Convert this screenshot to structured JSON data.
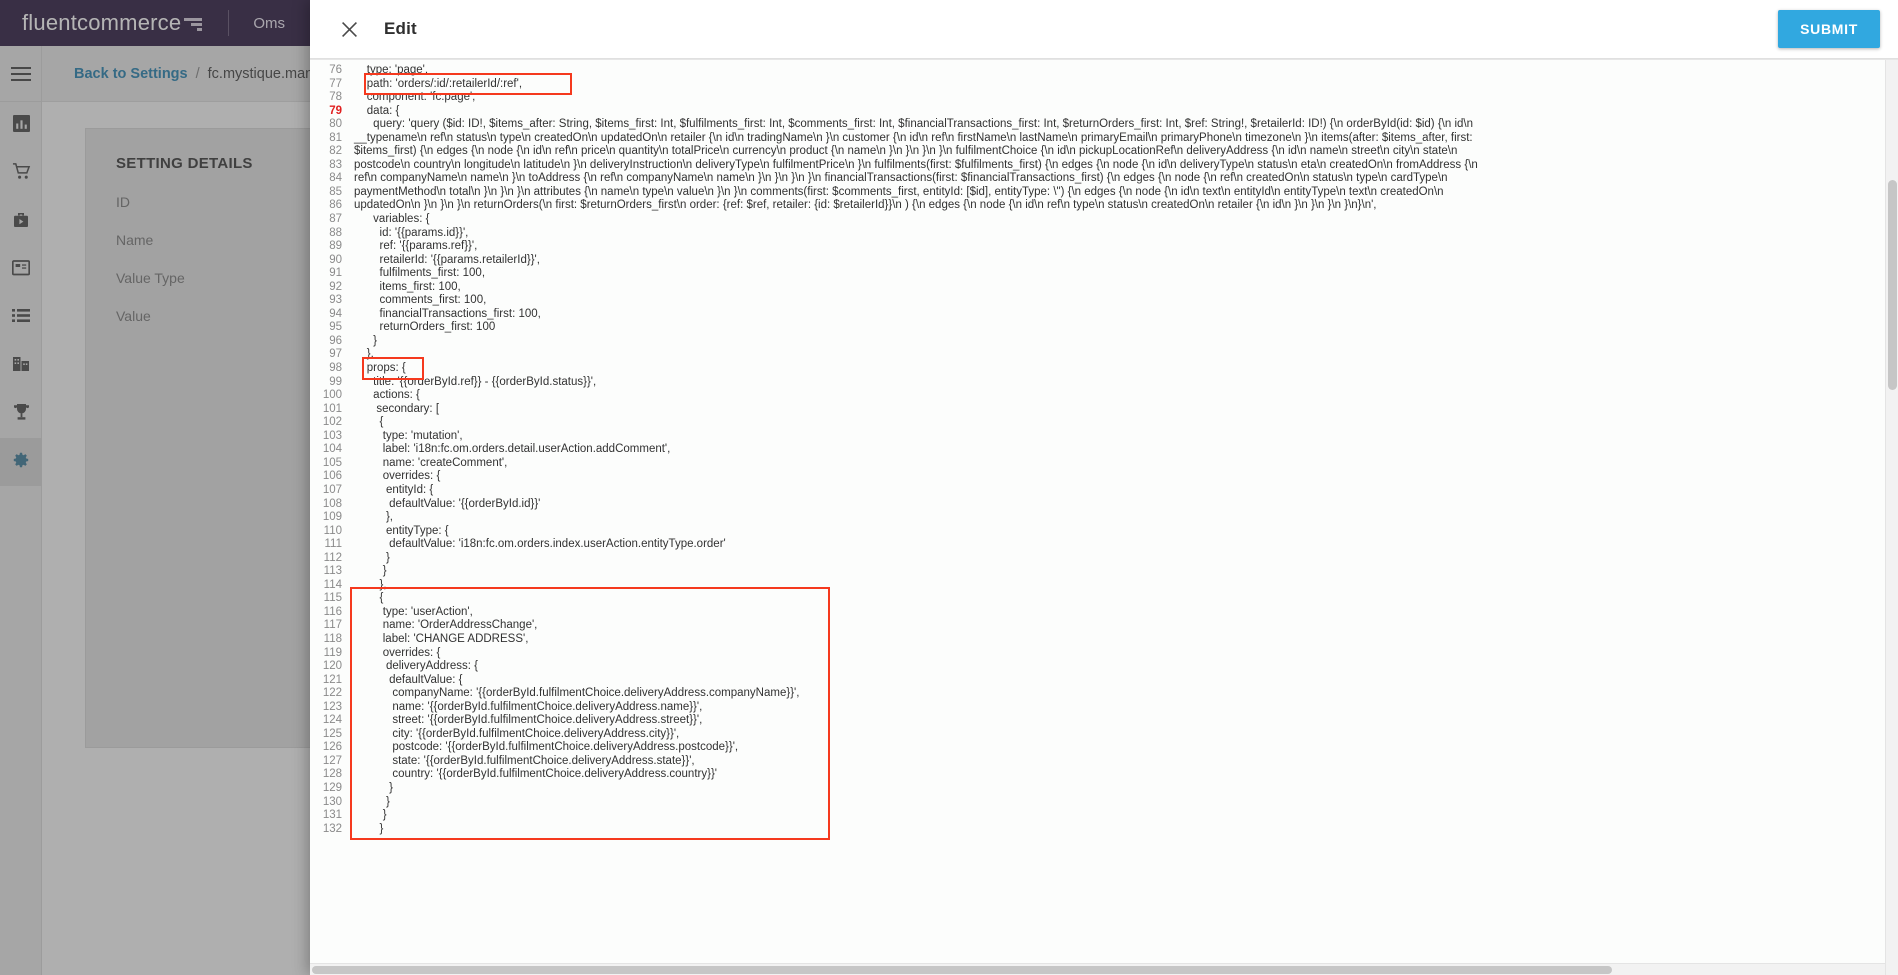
{
  "app": {
    "brand_name": "fluentcommerce",
    "app_name": "Oms"
  },
  "breadcrumb": {
    "back_link": "Back to Settings",
    "separator": "/",
    "current": "fc.mystique.manifest.oms.f"
  },
  "sidebar": {
    "items": [
      {
        "name": "menu-toggle",
        "icon": "hamburger-icon"
      },
      {
        "name": "dashboard",
        "icon": "bar-chart-icon"
      },
      {
        "name": "orders",
        "icon": "shopping-cart-icon"
      },
      {
        "name": "fulfilments",
        "icon": "briefcase-play-icon"
      },
      {
        "name": "inventory",
        "icon": "layout-panel-icon"
      },
      {
        "name": "lists",
        "icon": "list-icon"
      },
      {
        "name": "locations",
        "icon": "building-icon"
      },
      {
        "name": "rewards",
        "icon": "trophy-icon"
      },
      {
        "name": "settings",
        "icon": "gear-icon"
      }
    ]
  },
  "setting_panel": {
    "title": "SETTING DETAILS",
    "fields": [
      "ID",
      "Name",
      "Value Type",
      "Value"
    ]
  },
  "modal": {
    "title": "Edit",
    "close_icon": "close-icon",
    "submit_label": "SUBMIT"
  },
  "colors": {
    "brand_bar": "#1e0b33",
    "accent_blue": "#31a8e0",
    "link_blue": "#1777a8",
    "annotation_red": "#f5391e",
    "error_line": "#e02020"
  },
  "editor": {
    "first_line_number": 76,
    "error_line_number": 79,
    "lines": [
      {
        "n": 76,
        "text": "    type: 'page',"
      },
      {
        "n": 77,
        "text": "    path: 'orders/:id/:retailerId/:ref',"
      },
      {
        "n": 78,
        "text": "    component: 'fc.page',"
      },
      {
        "n": 79,
        "text": "    data: {",
        "error": true
      },
      {
        "n": 80,
        "text": "      query: 'query ($id: ID!, $items_after: String, $items_first: Int, $fulfilments_first: Int, $comments_first: Int, $financialTransactions_first: Int, $returnOrders_first: Int, $ref: String!, $retailerId: ID!) {\\n orderById(id: $id) {\\n id\\n"
      },
      {
        "n": 81,
        "text": "__typename\\n ref\\n status\\n type\\n createdOn\\n updatedOn\\n retailer {\\n id\\n tradingName\\n }\\n customer {\\n id\\n ref\\n firstName\\n lastName\\n primaryEmail\\n primaryPhone\\n timezone\\n }\\n items(after: $items_after, first:"
      },
      {
        "n": 82,
        "text": "$items_first) {\\n edges {\\n node {\\n id\\n ref\\n price\\n quantity\\n totalPrice\\n currency\\n product {\\n name\\n }\\n }\\n }\\n }\\n fulfilmentChoice {\\n id\\n pickupLocationRef\\n deliveryAddress {\\n id\\n name\\n street\\n city\\n state\\n"
      },
      {
        "n": 83,
        "text": "postcode\\n country\\n longitude\\n latitude\\n }\\n deliveryInstruction\\n deliveryType\\n fulfilmentPrice\\n }\\n fulfilments(first: $fulfilments_first) {\\n edges {\\n node {\\n id\\n deliveryType\\n status\\n eta\\n createdOn\\n fromAddress {\\n"
      },
      {
        "n": 84,
        "text": "ref\\n companyName\\n name\\n }\\n toAddress {\\n ref\\n companyName\\n name\\n }\\n }\\n }\\n }\\n financialTransactions(first: $financialTransactions_first) {\\n edges {\\n node {\\n ref\\n createdOn\\n status\\n type\\n cardType\\n"
      },
      {
        "n": 85,
        "text": "paymentMethod\\n total\\n }\\n }\\n }\\n attributes {\\n name\\n type\\n value\\n }\\n }\\n comments(first: $comments_first, entityId: [$id], entityType: \\\") {\\n edges {\\n node {\\n id\\n text\\n entityId\\n entityType\\n text\\n createdOn\\n"
      },
      {
        "n": 86,
        "text": "updatedOn\\n }\\n }\\n }\\n returnOrders(\\n first: $returnOrders_first\\n order: {ref: $ref, retailer: {id: $retailerId}}\\n ) {\\n edges {\\n node {\\n id\\n ref\\n type\\n status\\n createdOn\\n retailer {\\n id\\n }\\n }\\n }\\n }\\n}\\n',"
      },
      {
        "n": 87,
        "text": "      variables: {"
      },
      {
        "n": 88,
        "text": "        id: '{{params.id}}',"
      },
      {
        "n": 89,
        "text": "        ref: '{{params.ref}}',"
      },
      {
        "n": 90,
        "text": "        retailerId: '{{params.retailerId}}',"
      },
      {
        "n": 91,
        "text": "        fulfilments_first: 100,"
      },
      {
        "n": 92,
        "text": "        items_first: 100,"
      },
      {
        "n": 93,
        "text": "        comments_first: 100,"
      },
      {
        "n": 94,
        "text": "        financialTransactions_first: 100,"
      },
      {
        "n": 95,
        "text": "        returnOrders_first: 100"
      },
      {
        "n": 96,
        "text": "      }"
      },
      {
        "n": 97,
        "text": "    },"
      },
      {
        "n": 98,
        "text": "    props: {"
      },
      {
        "n": 99,
        "text": "      title: '{{orderById.ref}} - {{orderById.status}}',"
      },
      {
        "n": 100,
        "text": "      actions: {"
      },
      {
        "n": 101,
        "text": "       secondary: ["
      },
      {
        "n": 102,
        "text": "        {"
      },
      {
        "n": 103,
        "text": "         type: 'mutation',"
      },
      {
        "n": 104,
        "text": "         label: 'i18n:fc.om.orders.detail.userAction.addComment',"
      },
      {
        "n": 105,
        "text": "         name: 'createComment',"
      },
      {
        "n": 106,
        "text": "         overrides: {"
      },
      {
        "n": 107,
        "text": "          entityId: {"
      },
      {
        "n": 108,
        "text": "           defaultValue: '{{orderById.id}}'"
      },
      {
        "n": 109,
        "text": "          },"
      },
      {
        "n": 110,
        "text": "          entityType: {"
      },
      {
        "n": 111,
        "text": "           defaultValue: 'i18n:fc.om.orders.index.userAction.entityType.order'"
      },
      {
        "n": 112,
        "text": "          }"
      },
      {
        "n": 113,
        "text": "         }"
      },
      {
        "n": 114,
        "text": "        },"
      },
      {
        "n": 115,
        "text": "        {"
      },
      {
        "n": 116,
        "text": "         type: 'userAction',"
      },
      {
        "n": 117,
        "text": "         name: 'OrderAddressChange',"
      },
      {
        "n": 118,
        "text": "         label: 'CHANGE ADDRESS',"
      },
      {
        "n": 119,
        "text": "         overrides: {"
      },
      {
        "n": 120,
        "text": "          deliveryAddress: {"
      },
      {
        "n": 121,
        "text": "           defaultValue: {"
      },
      {
        "n": 122,
        "text": "            companyName: '{{orderById.fulfilmentChoice.deliveryAddress.companyName}}',"
      },
      {
        "n": 123,
        "text": "            name: '{{orderById.fulfilmentChoice.deliveryAddress.name}}',"
      },
      {
        "n": 124,
        "text": "            street: '{{orderById.fulfilmentChoice.deliveryAddress.street}}',"
      },
      {
        "n": 125,
        "text": "            city: '{{orderById.fulfilmentChoice.deliveryAddress.city}}',"
      },
      {
        "n": 126,
        "text": "            postcode: '{{orderById.fulfilmentChoice.deliveryAddress.postcode}}',"
      },
      {
        "n": 127,
        "text": "            state: '{{orderById.fulfilmentChoice.deliveryAddress.state}}',"
      },
      {
        "n": 128,
        "text": "            country: '{{orderById.fulfilmentChoice.deliveryAddress.country}}'"
      },
      {
        "n": 129,
        "text": "           }"
      },
      {
        "n": 130,
        "text": "          }"
      },
      {
        "n": 131,
        "text": "         }"
      },
      {
        "n": 132,
        "text": "        }"
      }
    ],
    "annotations": [
      {
        "name": "path-highlight",
        "line": 77,
        "label": "path: 'orders/:id/:retailerId/:ref',"
      },
      {
        "name": "props-highlight",
        "line": 98,
        "label": "props: {"
      },
      {
        "name": "change-address-action-highlight",
        "line_start": 115,
        "line_end": 132,
        "label": "CHANGE ADDRESS action block"
      }
    ]
  }
}
